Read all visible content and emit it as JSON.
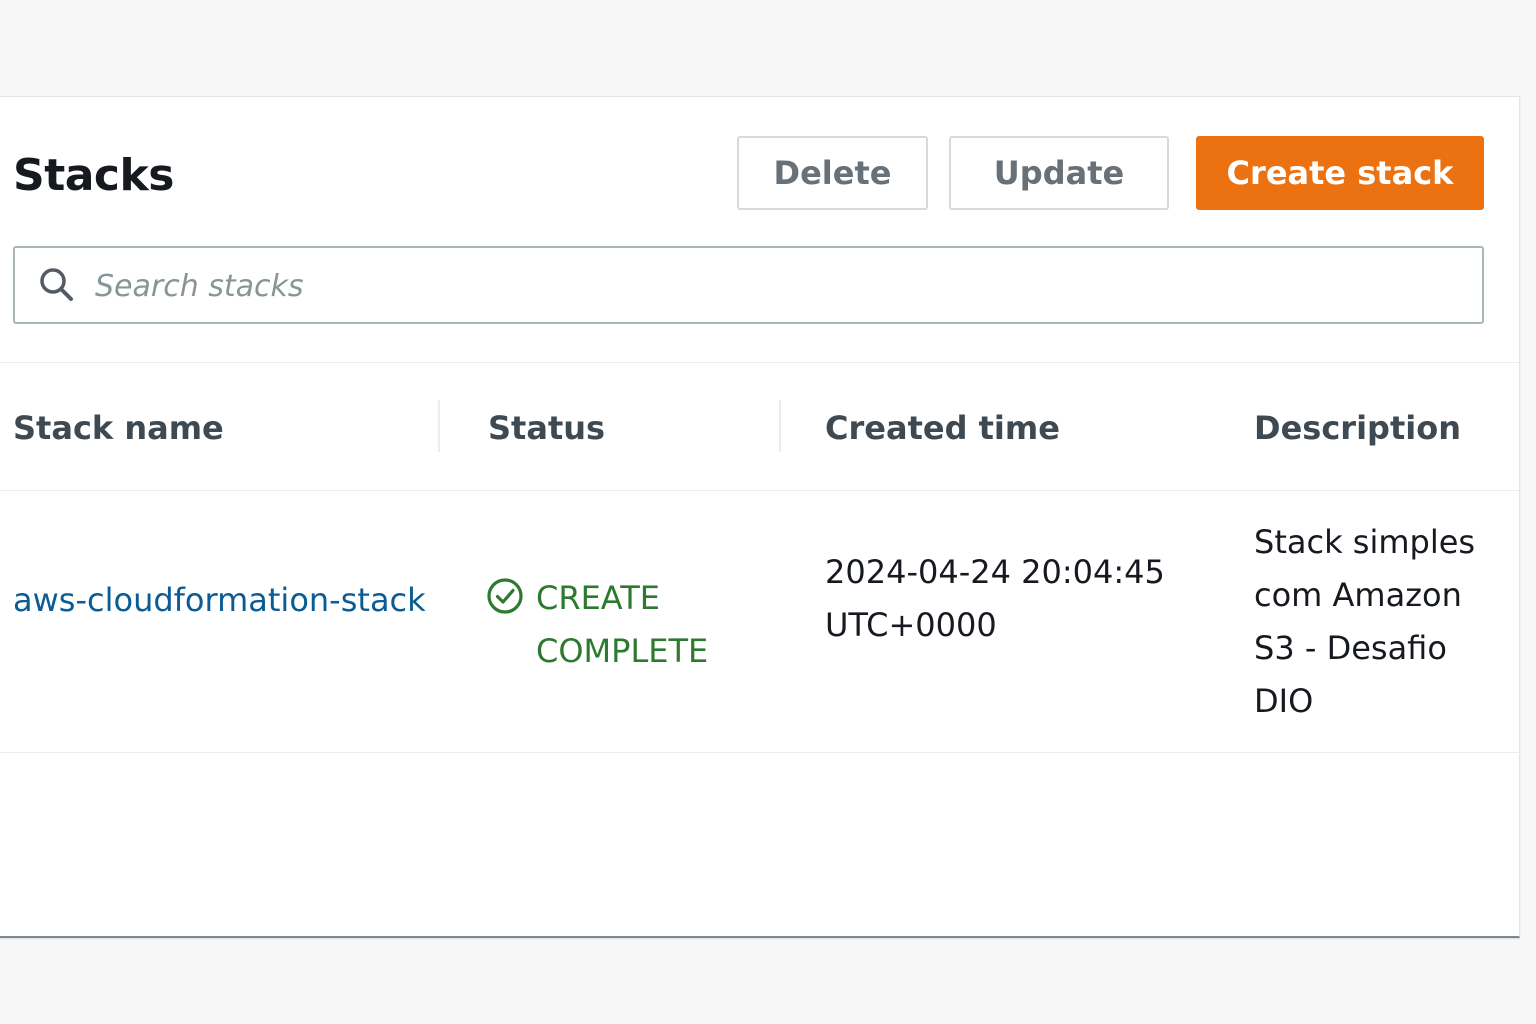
{
  "page": {
    "title": "Stacks"
  },
  "toolbar": {
    "delete_label": "Delete",
    "update_label": "Update",
    "create_label": "Create stack"
  },
  "search": {
    "placeholder": "Search stacks",
    "value": "",
    "icon": "search-icon"
  },
  "table": {
    "columns": [
      "Stack name",
      "Status",
      "Created time",
      "Description"
    ],
    "rows": [
      {
        "stack_name": "aws-cloudformation-stack",
        "status_icon": "check-circle-icon",
        "status_line1": "CREATE",
        "status_line2": "COMPLETE",
        "created_line1": "2024-04-24 20:04:45",
        "created_line2": "UTC+0000",
        "description_lines": [
          "Stack simples",
          "com Amazon",
          "S3 - Desafio",
          "DIO"
        ]
      }
    ]
  },
  "colors": {
    "primary": "#ec7211",
    "link": "#0b5c94",
    "success": "#2d7a2f",
    "text": "#16191f",
    "header_text": "#3f4952"
  }
}
